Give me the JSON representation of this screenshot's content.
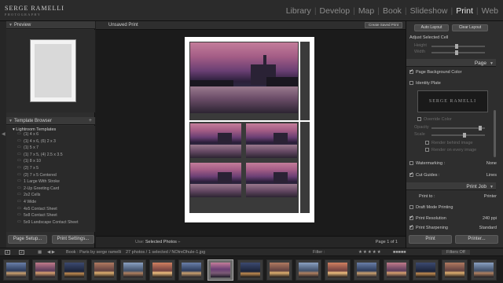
{
  "branding": {
    "line1": "SERGE RAMELLI",
    "line2": "PHOTOGRAPHY"
  },
  "modules": [
    "Library",
    "Develop",
    "Map",
    "Book",
    "Slideshow",
    "Print",
    "Web"
  ],
  "active_module": "Print",
  "left_panel": {
    "preview_title": "Preview",
    "template_browser_title": "Template Browser",
    "folder": "Lightroom Templates",
    "templates": [
      "(1) 4 x 6",
      "(1) 4 x 6, (6) 2 x 3",
      "(1) 5 x 7",
      "(1) 7 x 5, (4) 2.5 x 3.5",
      "(1) 8 x 10",
      "(2) 7 x 5",
      "(2) 7 x 5 Centered",
      "1 Large With Stroke",
      "2-Up Greeting Card",
      "2x2 Cells",
      "4 Wide",
      "4x5 Contact Sheet",
      "5x8 Contact Sheet",
      "5x9 Landscape Contact Sheet"
    ],
    "page_setup_label": "Page Setup...",
    "print_settings_label": "Print Settings..."
  },
  "center": {
    "title": "Unsaved Print",
    "create_saved_print_label": "Create Saved Print",
    "use_label": "Use:",
    "use_value": "Selected Photos",
    "page_indicator": "Page 1 of 1"
  },
  "right_panel": {
    "auto_layout_label": "Auto Layout",
    "clear_layout_label": "Clear Layout",
    "adjust_selected_cell": "Adjust Selected Cell",
    "height_label": "Height",
    "width_label": "Width",
    "page_section": "Page",
    "page_bg_label": "Page Background Color",
    "identity_plate_label": "Identity Plate",
    "identity_plate_text": "SERGE RAMELLI",
    "override_color_label": "Override Color",
    "opacity_label": "Opacity",
    "scale_label": "Scale",
    "render_behind_label": "Render behind image",
    "render_every_label": "Render on every image",
    "watermarking_label": "Watermarking :",
    "watermark_value": "None",
    "cut_guides_label": "Cut Guides :",
    "cut_guides_value": "Lines",
    "print_job_section": "Print Job",
    "print_to_label": "Print to :",
    "print_to_value": "Printer",
    "draft_mode_label": "Draft Mode Printing",
    "print_resolution_label": "Print Resolution",
    "print_resolution_value": "240",
    "print_resolution_unit": "ppi",
    "print_sharpening_label": "Print Sharpening",
    "print_sharpening_value": "Standard",
    "print_button": "Print",
    "printer_button": "Printer..."
  },
  "filmstrip": {
    "page_numbers": [
      "1",
      "2"
    ],
    "source": "Book : Paris by serge ramelli",
    "count": "27 photos / 1 selected / NOtreDhule-1.jpg",
    "filter_label": "Filter :",
    "filters_off": "Filters Off"
  },
  "colors": {
    "accent": "#e8e8e8",
    "panel": "#2e2e2e",
    "background": "#1b1b1b"
  }
}
